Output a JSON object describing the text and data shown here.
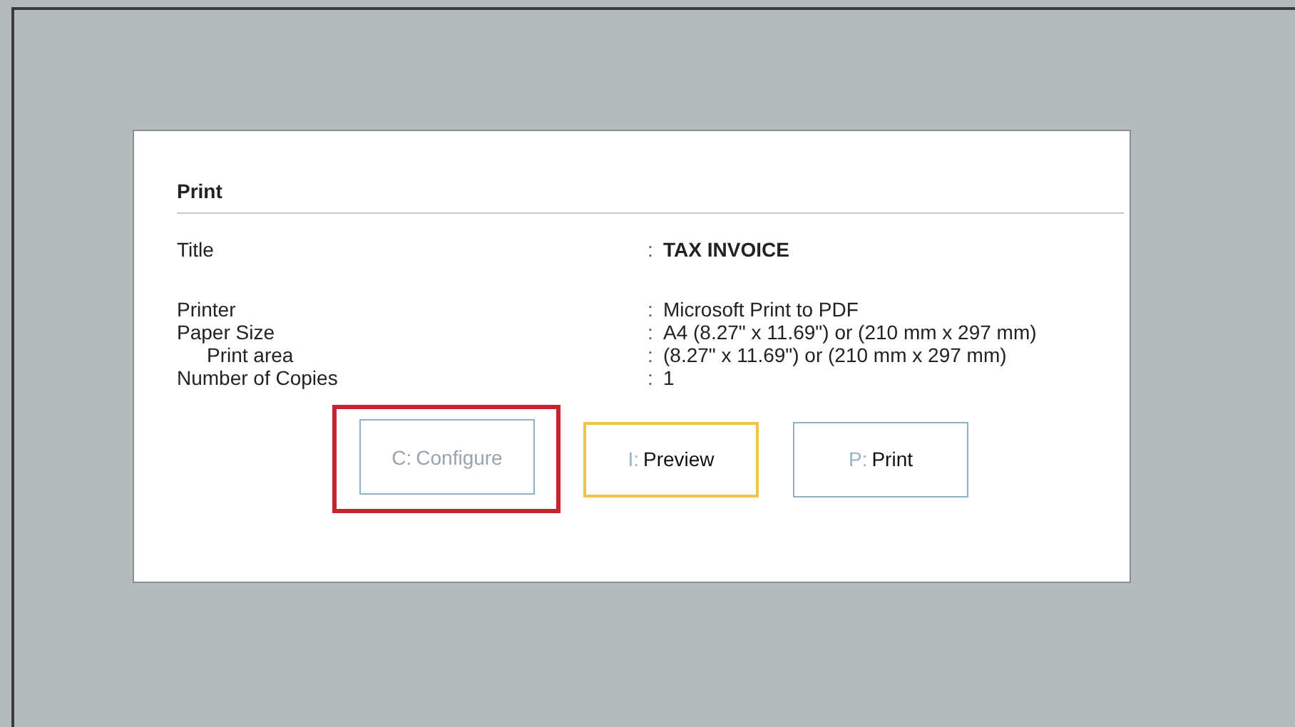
{
  "dialog": {
    "title": "Print",
    "fields": [
      {
        "label": "Title",
        "separator": ":",
        "value": "TAX INVOICE",
        "kind": "heading"
      },
      {
        "label": "Printer",
        "separator": ":",
        "value": "Microsoft Print to PDF",
        "kind": "plain"
      },
      {
        "label": "Paper Size",
        "separator": ":",
        "value": "A4 (8.27\" x 11.69\") or (210 mm x 297 mm)",
        "kind": "plain"
      },
      {
        "label": "Print area",
        "separator": ":",
        "value": "(8.27\" x 11.69\") or (210 mm x 297 mm)",
        "kind": "sub"
      },
      {
        "label": "Number of Copies",
        "separator": ":",
        "value": "1",
        "kind": "plain"
      }
    ],
    "buttons": [
      {
        "key": "C:",
        "label": "Configure",
        "disabled": true,
        "focused": false,
        "highlighted": true
      },
      {
        "key": "I:",
        "label": "Preview",
        "disabled": false,
        "focused": true,
        "highlighted": false
      },
      {
        "key": "P:",
        "label": "Print",
        "disabled": false,
        "focused": false,
        "highlighted": false
      }
    ]
  }
}
